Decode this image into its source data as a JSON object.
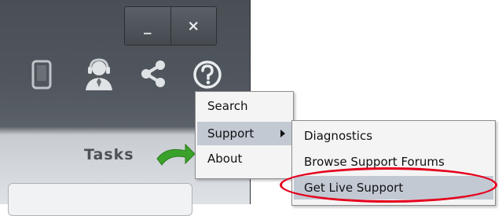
{
  "window_controls": {
    "minimize": "_",
    "close": "×"
  },
  "toolbar_icons": [
    "mobile-icon",
    "live-support-agent-icon",
    "share-icon",
    "help-icon"
  ],
  "tasks": {
    "label": "Tasks"
  },
  "help_menu": {
    "items": [
      {
        "label": "Search"
      },
      {
        "label": "Support",
        "has_submenu": true,
        "selected": true
      },
      {
        "label": "About"
      }
    ]
  },
  "support_submenu": {
    "items": [
      {
        "label": "Diagnostics"
      },
      {
        "label": "Browse Support Forums"
      },
      {
        "label": "Get Live Support",
        "selected": true,
        "annotated": true
      }
    ]
  },
  "colors": {
    "selection": "#c2c9d3",
    "annotation": "#e5001c",
    "tasks_arrow": "#3aa12a"
  }
}
